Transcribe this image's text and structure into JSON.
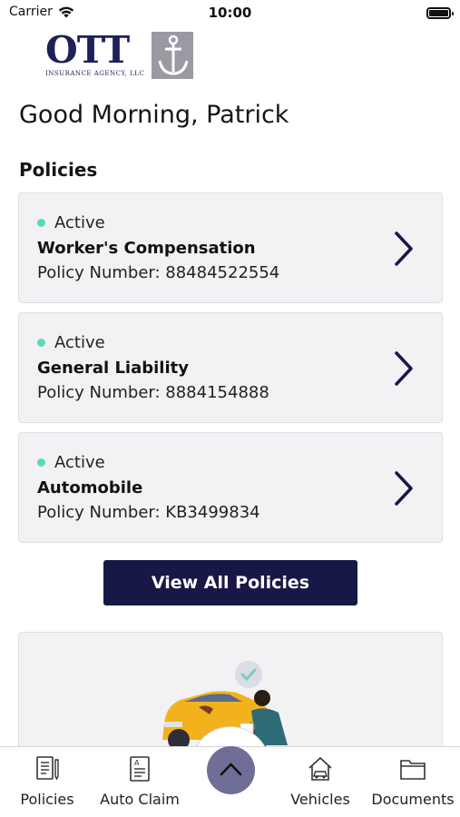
{
  "status_bar": {
    "carrier": "Carrier",
    "time": "10:00"
  },
  "logo": {
    "name": "OTT",
    "subtitle": "INSURANCE AGENCY, LLC"
  },
  "greeting": "Good Morning, Patrick",
  "policies_section": {
    "title": "Policies",
    "items": [
      {
        "status": "Active",
        "name": "Worker's Compensation",
        "number": "Policy Number: 88484522554"
      },
      {
        "status": "Active",
        "name": "General Liability",
        "number": "Policy Number: 8884154888"
      },
      {
        "status": "Active",
        "name": "Automobile",
        "number": "Policy Number: KB3499834"
      }
    ],
    "view_all_label": "View All Policies"
  },
  "tab_bar": {
    "tabs": [
      {
        "label": "Policies",
        "icon": "policy-document-icon"
      },
      {
        "label": "Auto Claim",
        "icon": "claim-form-icon"
      },
      {
        "label": "Vehicles",
        "icon": "house-car-icon"
      },
      {
        "label": "Documents",
        "icon": "folder-icon"
      }
    ],
    "center_action_icon": "chevron-up-icon"
  },
  "colors": {
    "brand_navy": "#181846",
    "status_active": "#5ed9b8",
    "card_background": "#f2f2f5",
    "fab": "#6e6e96"
  }
}
